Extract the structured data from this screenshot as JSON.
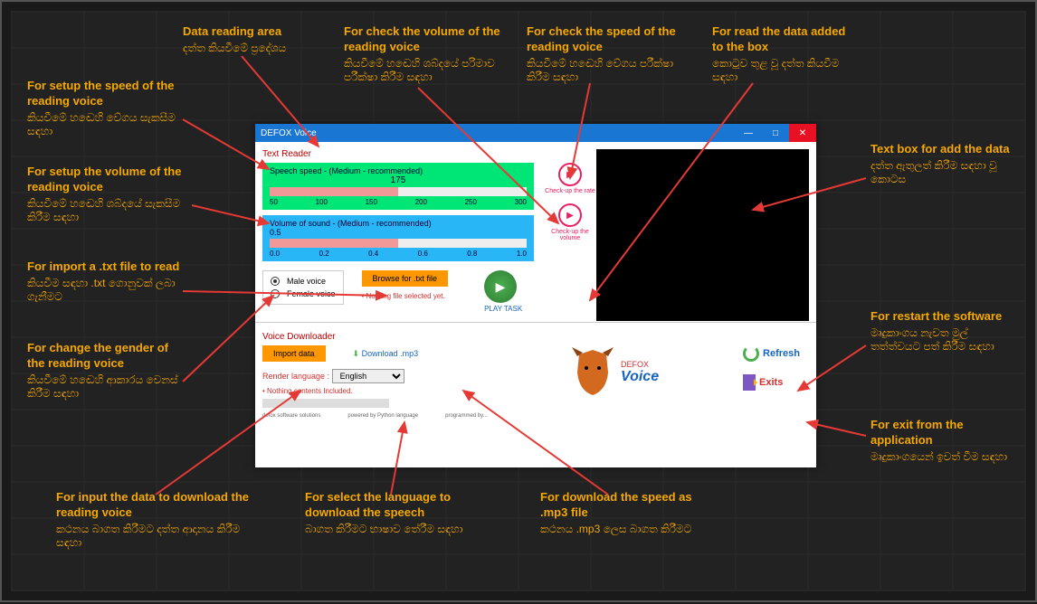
{
  "annotations": {
    "data_reading": {
      "en": "Data reading area",
      "si": "දත්ත කියවීමේ ප්‍රදේශය"
    },
    "check_volume": {
      "en": "For check the volume of the reading voice",
      "si": "කියවීමේ හඬෙහි ශබ්දයේ පරිමාව පරීක්ෂා කිරීම සඳහා"
    },
    "check_speed": {
      "en": "For check the speed of the reading voice",
      "si": "කියවීමේ හඬෙහි වේගය පරීක්ෂා කිරීම සඳහා"
    },
    "read_data": {
      "en": "For read the data added to the box",
      "si": "කොටුව තුළ වූ දත්ත කියවීම සඳහා"
    },
    "setup_speed": {
      "en": "For setup the speed of the reading voice",
      "si": "කියවීමේ හඬෙහි වේගය සැකසීම සඳහා"
    },
    "setup_volume": {
      "en": "For setup the volume of the reading voice",
      "si": "කියවීමේ හඬෙහි ශබ්දයේ සැකසීම කිරීම සඳහා"
    },
    "import_txt": {
      "en": "For import a .txt file to read",
      "si": "කියවීම සඳහා .txt ගොනුවක් ලබා ගැනීමට"
    },
    "change_gender": {
      "en": "For change the gender of the reading voice",
      "si": "කියවීමේ හඬෙහි ආකාරය වෙනස් කිරීම සඳහා"
    },
    "text_box": {
      "en": "Text box for add the data",
      "si": "දත්ත ඇතුලත් කිරීම සඳහා වූ කොටස"
    },
    "restart": {
      "en": "For restart the software",
      "si": "මෘදුකාංගය නැවත මුල් තත්ත්වයට පත් කිරීම සඳහා"
    },
    "exit": {
      "en": "For exit from the application",
      "si": "මෘදුකාංගයෙන් ඉවත් වීම සඳහා"
    },
    "input_download": {
      "en": "For input the data to download the reading voice",
      "si": "කථනය බාගත කිරීමට දත්ත ආදානය කිරීම සඳහා"
    },
    "select_lang": {
      "en": "For select the language to download the speech",
      "si": "බාගත කිරීමට භාෂාව තේරීම සඳහා"
    },
    "download_mp3": {
      "en": "For download the speed as .mp3 file",
      "si": "කථනය .mp3 ලෙස බාගත කිරීමට"
    }
  },
  "window": {
    "title": "DEFOX Voice",
    "text_reader_label": "Text Reader",
    "speed_label": "Speech speed - (Medium - recommended)",
    "speed_value": "175",
    "speed_ticks": [
      "50",
      "100",
      "150",
      "200",
      "250",
      "300"
    ],
    "volume_label": "Volume of sound - (Medium - recommended)",
    "volume_value": "0.5",
    "volume_ticks": [
      "0.0",
      "0.2",
      "0.4",
      "0.6",
      "0.8",
      "1.0"
    ],
    "check_rate": "Check-up the rate",
    "check_vol": "Check-up the volume",
    "male_voice": "Male voice",
    "female_voice": "Female voice",
    "browse_btn": "Browse for .txt file",
    "nothing_file": "• Nothing file selected yet.",
    "play_task": "PLAY TASK",
    "downloader_label": "Voice Downloader",
    "import_data": "Import data",
    "download_mp3": "Download .mp3",
    "render_lang_label": "Render language :",
    "render_lang_value": "English",
    "nothing_contents": "• Nothing contents Included.",
    "refresh": "Refresh",
    "exits": "Exits",
    "logo_brand": "DEFOX",
    "logo_voice": "Voice",
    "footer1": "defox software solutions",
    "footer2": "powered by Python language",
    "footer3": "programmed by..."
  }
}
